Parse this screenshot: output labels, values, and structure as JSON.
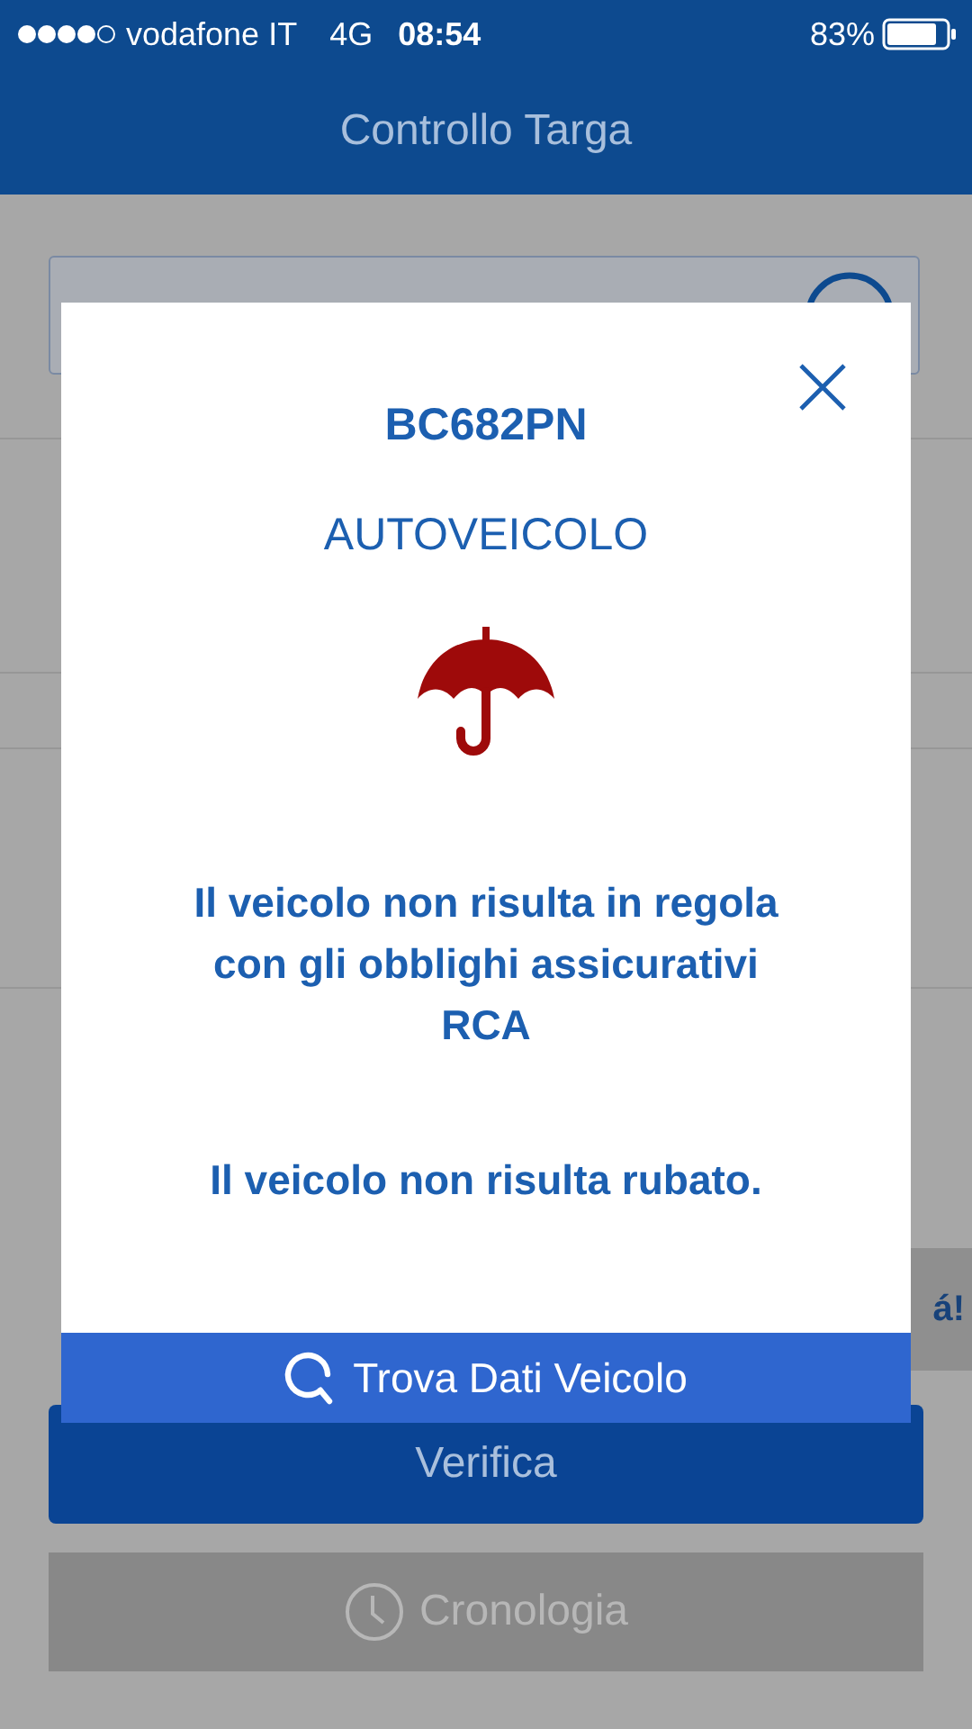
{
  "status_bar": {
    "carrier": "vodafone IT",
    "network": "4G",
    "time": "08:54",
    "battery": "83%"
  },
  "header": {
    "title": "Controllo Targa"
  },
  "background": {
    "banner_text": "á!",
    "buttons": [
      {
        "label": "Verifica",
        "kind": "primary",
        "disabled": false
      },
      {
        "label": "Cronologia",
        "kind": "history",
        "disabled": true
      }
    ]
  },
  "dialog": {
    "plate": "BC682PN",
    "vehicle_type": "AUTOVEICOLO",
    "insurance_message": "Il veicolo non risulta in regola con gli obblighi assicurativi RCA",
    "theft_message": "Il veicolo non risulta rubato.",
    "action": "Trova Dati Veicolo"
  }
}
